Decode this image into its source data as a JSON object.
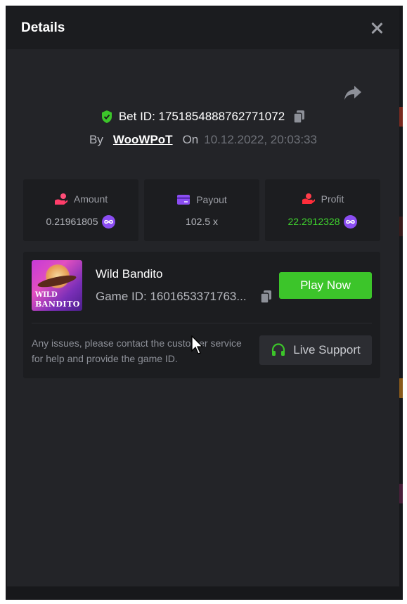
{
  "header": {
    "title": "Details"
  },
  "bet": {
    "label": "Bet ID: 1751854888762771072",
    "by_label": "By",
    "user": "WooWPoT",
    "on_label": "On",
    "datetime": "10.12.2022, 20:03:33"
  },
  "stats": [
    {
      "label": "Amount",
      "value": "0.21961805",
      "icon": "amount-hand-icon",
      "has_coin": true
    },
    {
      "label": "Payout",
      "value": "102.5 x",
      "icon": "card-icon",
      "has_coin": false
    },
    {
      "label": "Profit",
      "value": "22.2912328",
      "icon": "profit-hand-icon",
      "has_coin": true
    }
  ],
  "game": {
    "name": "Wild Bandito",
    "id": "Game ID: 1601653371763...",
    "thumb_text_top": "WILD",
    "thumb_text_bottom": "BANDITO",
    "play_label": "Play Now",
    "issue_text": "Any issues, please contact the customer service for help and provide the game ID.",
    "support_label": "Live Support"
  },
  "colors": {
    "accent_green": "#3cc52a",
    "profit_green": "#3fd12e",
    "coin_purple": "#8b4df2",
    "modal_bg": "#232428",
    "header_bg": "#1b1c1f"
  }
}
